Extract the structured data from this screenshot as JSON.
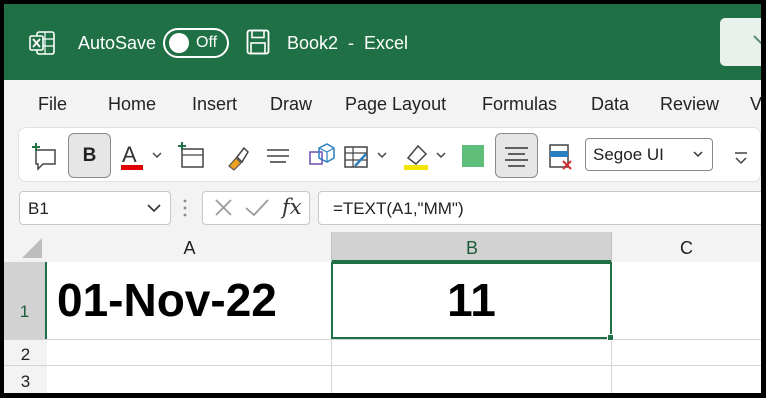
{
  "titlebar": {
    "autosave_label": "AutoSave",
    "autosave_state": "Off",
    "doc_title": "Book2  -  Excel",
    "brand_color": "#1f7145"
  },
  "menu": {
    "items": [
      "File",
      "Home",
      "Insert",
      "Draw",
      "Page Layout",
      "Formulas",
      "Data",
      "Review",
      "V"
    ]
  },
  "toolbar": {
    "bold_label": "B",
    "font_color": "#e00000",
    "highlight_color": "#f2e600",
    "fill_color": "#5fbf7a",
    "font_name": "Segoe UI"
  },
  "formula_bar": {
    "name_box": "B1",
    "fx_label": "fx",
    "formula": "=TEXT(A1,\"MM\")"
  },
  "grid": {
    "columns": [
      "A",
      "B",
      "C"
    ],
    "rows": [
      "1",
      "2",
      "3"
    ],
    "cells": {
      "A1": "01-Nov-22",
      "B1": "11"
    },
    "selected_cell": "B1"
  }
}
